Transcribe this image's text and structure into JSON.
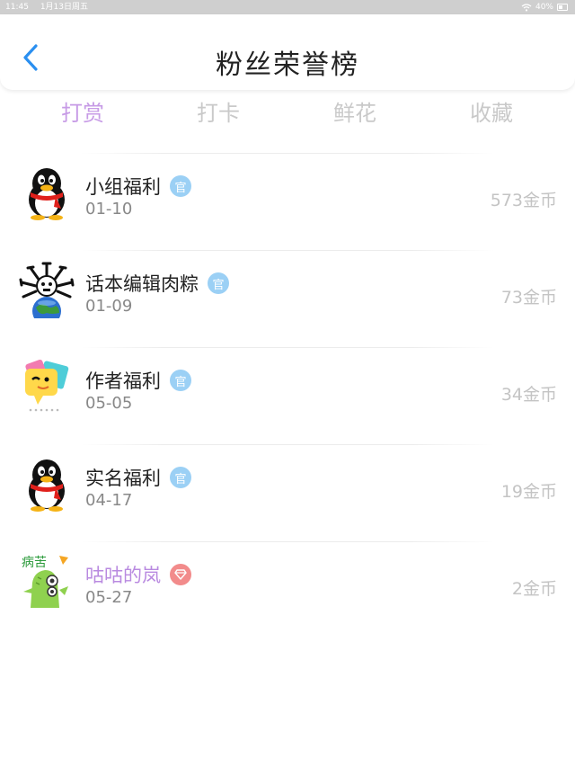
{
  "status_bar": {
    "time": "11:45",
    "date": "1月13日周五",
    "battery": "40%"
  },
  "header": {
    "title": "粉丝荣誉榜"
  },
  "tabs": [
    {
      "label": "打赏",
      "active": true
    },
    {
      "label": "打卡",
      "active": false
    },
    {
      "label": "鲜花",
      "active": false
    },
    {
      "label": "收藏",
      "active": false
    }
  ],
  "rows": [
    {
      "name": "小组福利",
      "badge": "官",
      "badge_type": "official",
      "date": "01-10",
      "amount": "573金币",
      "avatar": "penguin-avatar"
    },
    {
      "name": "话本编辑肉粽",
      "badge": "官",
      "badge_type": "official",
      "date": "01-09",
      "amount": "73金币",
      "avatar": "earth-spider-avatar"
    },
    {
      "name": "作者福利",
      "badge": "官",
      "badge_type": "official",
      "date": "05-05",
      "amount": "34金币",
      "avatar": "chat-bubble-avatar"
    },
    {
      "name": "实名福利",
      "badge": "官",
      "badge_type": "official",
      "date": "04-17",
      "amount": "19金币",
      "avatar": "penguin-avatar"
    },
    {
      "name": "咕咕的岚",
      "badge": "",
      "badge_type": "diamond",
      "date": "05-27",
      "amount": "2金币",
      "avatar": "green-monster-avatar",
      "avatar_text": "病苦"
    }
  ],
  "colors": {
    "accent_purple": "#c79be6",
    "official_badge": "#9bd0f5",
    "diamond_badge": "#f28b8b",
    "back_arrow": "#2a8ff0"
  }
}
